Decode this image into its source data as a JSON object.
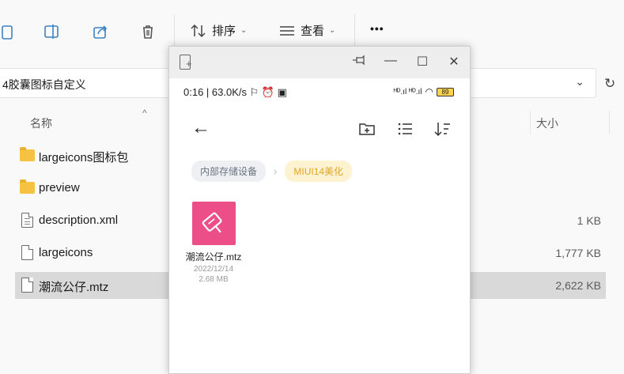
{
  "toolbar": {
    "sort_label": "排序",
    "view_label": "查看",
    "more_label": "•••"
  },
  "address": {
    "path": "4胶囊图标自定义"
  },
  "columns": {
    "name": "名称",
    "size": "大小"
  },
  "files": [
    {
      "name": "largeicons图标包",
      "type": "folder",
      "size": ""
    },
    {
      "name": "preview",
      "type": "folder",
      "size": ""
    },
    {
      "name": "description.xml",
      "type": "xml",
      "size": "1 KB"
    },
    {
      "name": "largeicons",
      "type": "file",
      "size": "1,777 KB"
    },
    {
      "name": "潮流公仔.mtz",
      "type": "file",
      "size": "2,622 KB",
      "selected": true
    }
  ],
  "phone": {
    "status_left": "0:16 | 63.0K/s ⚐ ⏰ ▣",
    "battery": "89",
    "signal": "ᴴᴰ.ıl ᴴᴰ.ıl",
    "breadcrumbs": [
      "内部存储设备",
      "MIUI14美化"
    ],
    "file": {
      "name": "潮流公仔.mtz",
      "date": "2022/12/14",
      "size": "2.68 MB"
    }
  },
  "colors": {
    "accent_pink": "#ec4e87",
    "chip_yellow_text": "#e0a52a",
    "selected_row": "#d9d9d9"
  }
}
